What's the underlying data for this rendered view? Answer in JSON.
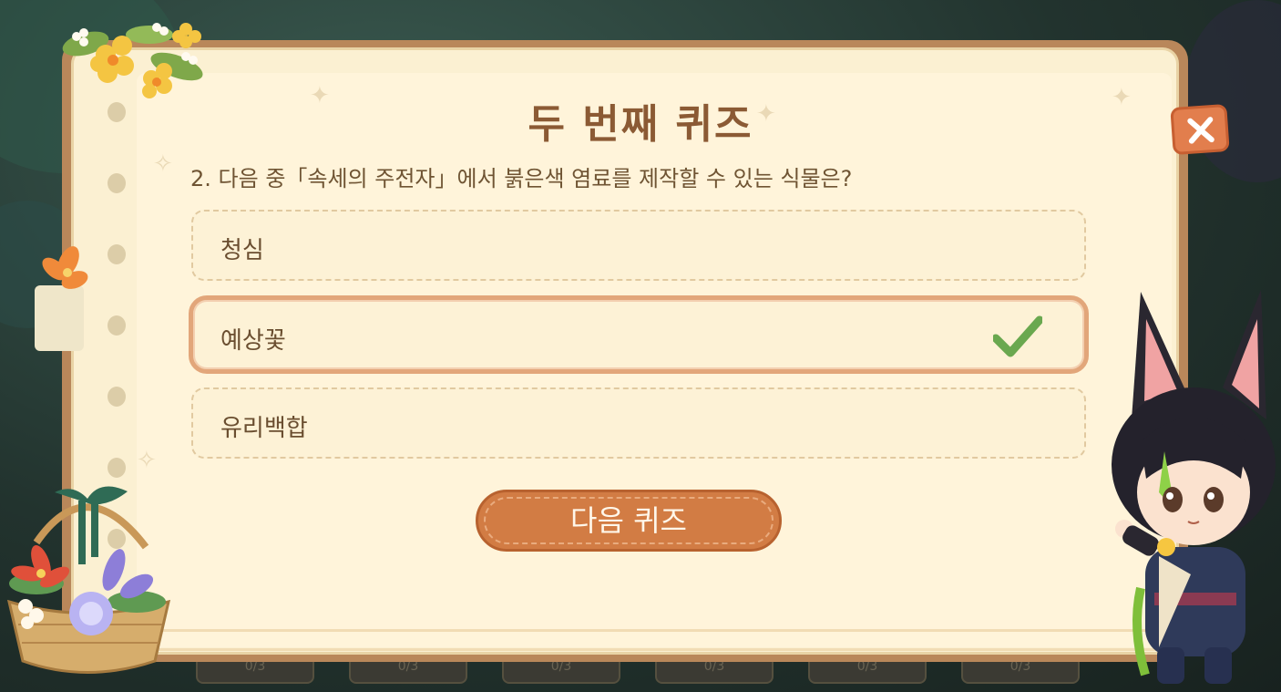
{
  "quiz": {
    "title": "두 번째 퀴즈",
    "question": "2. 다음 중「속세의 주전자」에서 붉은색 염료를 제작할 수 있는 식물은?",
    "options": [
      {
        "label": "청심",
        "selected": false
      },
      {
        "label": "예상꽃",
        "selected": true
      },
      {
        "label": "유리백합",
        "selected": false
      }
    ],
    "next_label": "다음 퀴즈"
  },
  "background": {
    "slot_labels": [
      "0/3",
      "0/3",
      "0/3",
      "0/3",
      "0/3",
      "0/3"
    ]
  },
  "icons": {
    "close": "close-icon",
    "check": "check-icon"
  },
  "colors": {
    "title": "#8b5a34",
    "accent": "#d27c44",
    "selected_border": "#e2a67a",
    "check": "#6aa84f"
  }
}
